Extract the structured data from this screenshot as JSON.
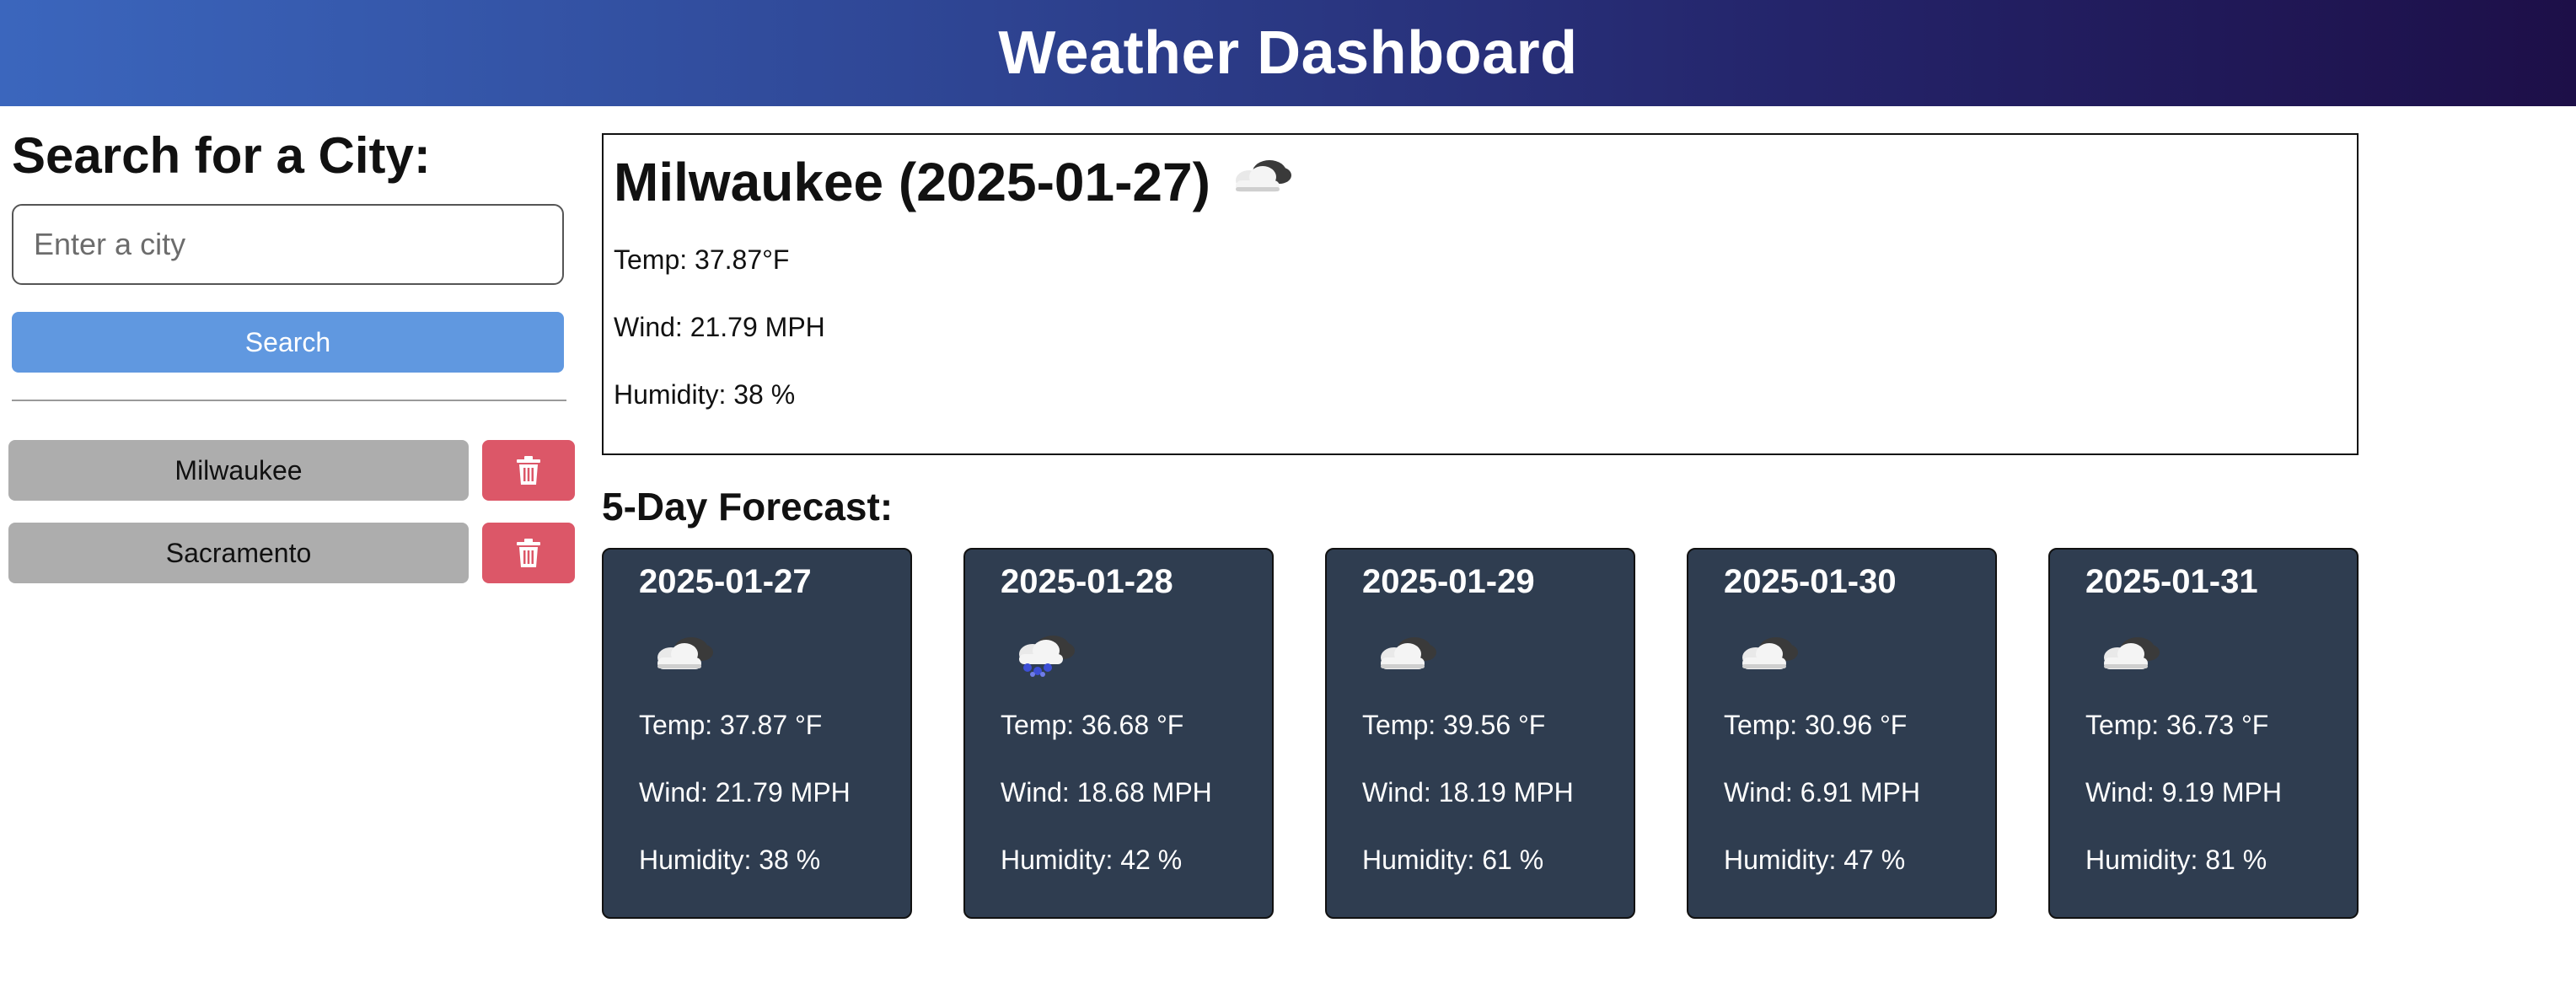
{
  "header": {
    "title": "Weather Dashboard"
  },
  "sidebar": {
    "heading": "Search for a City:",
    "search_placeholder": "Enter a city",
    "search_value": "",
    "search_button": "Search",
    "history": [
      {
        "city": "Milwaukee",
        "delete_icon": "trash-icon"
      },
      {
        "city": "Sacramento",
        "delete_icon": "trash-icon"
      }
    ]
  },
  "current": {
    "title": "Milwaukee (2025-01-27)",
    "icon": "cloudy-icon",
    "temp": "Temp: 37.87°F",
    "wind": "Wind: 21.79 MPH",
    "humidity": "Humidity: 38 %"
  },
  "forecast": {
    "heading": "5-Day Forecast:",
    "days": [
      {
        "date": "2025-01-27",
        "icon": "cloudy-icon",
        "temp": "Temp: 37.87 °F",
        "wind": "Wind: 21.79 MPH",
        "humidity": "Humidity: 38 %"
      },
      {
        "date": "2025-01-28",
        "icon": "snow-cloud-icon",
        "temp": "Temp: 36.68 °F",
        "wind": "Wind: 18.68 MPH",
        "humidity": "Humidity: 42 %"
      },
      {
        "date": "2025-01-29",
        "icon": "cloudy-icon",
        "temp": "Temp: 39.56 °F",
        "wind": "Wind: 18.19 MPH",
        "humidity": "Humidity: 61 %"
      },
      {
        "date": "2025-01-30",
        "icon": "cloudy-icon",
        "temp": "Temp: 30.96 °F",
        "wind": "Wind: 6.91 MPH",
        "humidity": "Humidity: 47 %"
      },
      {
        "date": "2025-01-31",
        "icon": "cloudy-icon",
        "temp": "Temp: 36.73 °F",
        "wind": "Wind: 9.19 MPH",
        "humidity": "Humidity: 81 %"
      }
    ]
  },
  "colors": {
    "header_gradient_start": "#3b66bd",
    "header_gradient_end": "#1d0f48",
    "search_button": "#6098e0",
    "history_button": "#adadad",
    "delete_button": "#dc5768",
    "card_background": "#2f3d50"
  }
}
